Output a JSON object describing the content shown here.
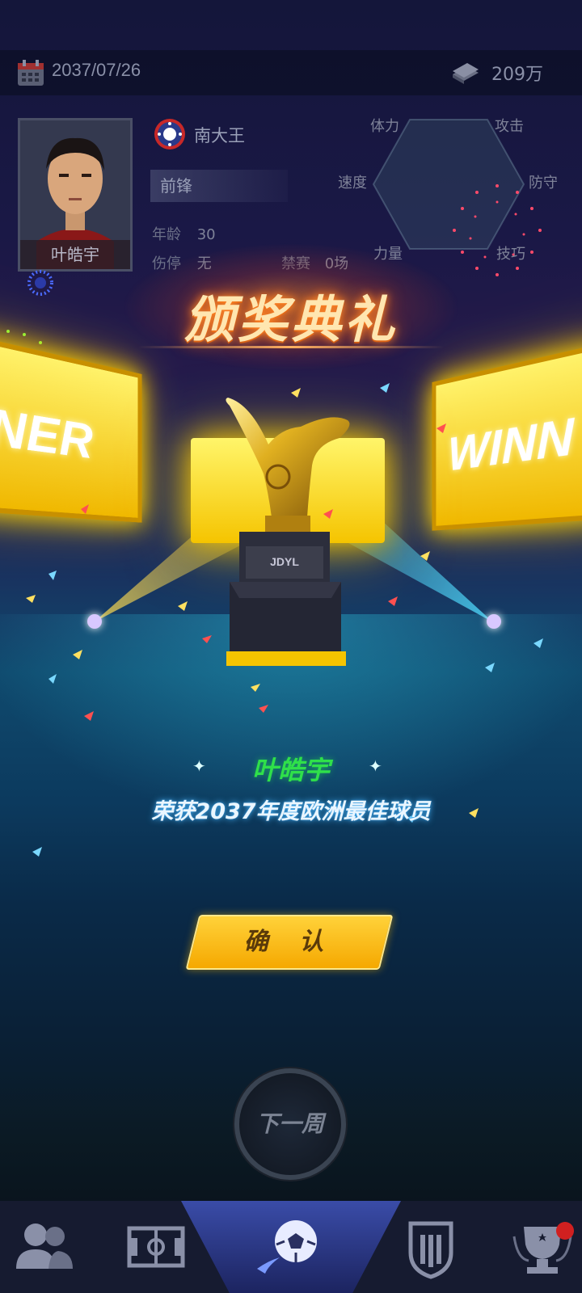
{
  "top_bar": {
    "date": "2037/07/26",
    "money": "209万",
    "calendar_icon": "calendar-icon",
    "money_icon": "cash-icon"
  },
  "player": {
    "name": "叶皓宇",
    "club": "南大王",
    "position": "前锋",
    "age_label": "年龄",
    "age_value": "30",
    "injury_label": "伤停",
    "injury_value": "无",
    "suspension_label": "禁赛",
    "suspension_value": "0场"
  },
  "radar_labels": {
    "stamina": "体力",
    "attack": "攻击",
    "speed": "速度",
    "defense": "防守",
    "strength": "力量",
    "skill": "技巧"
  },
  "ceremony": {
    "title": "颁奖典礼",
    "screen_left_text": "INER",
    "screen_right_text": "WINN",
    "trophy_plate": "JDYL",
    "winner_name": "叶皓宇",
    "award_text": "荣获2037年度欧洲最佳球员",
    "confirm_label": "确 认"
  },
  "next_week_label": "下一周",
  "bottom_nav": {
    "items": [
      "players-icon",
      "pitch-icon",
      "match-icon",
      "club-badge-icon",
      "trophy-icon"
    ]
  },
  "colors": {
    "accent_gold": "#ffd23a",
    "winner_green": "#2fe04a",
    "nav_active": "#3a4ca8"
  }
}
